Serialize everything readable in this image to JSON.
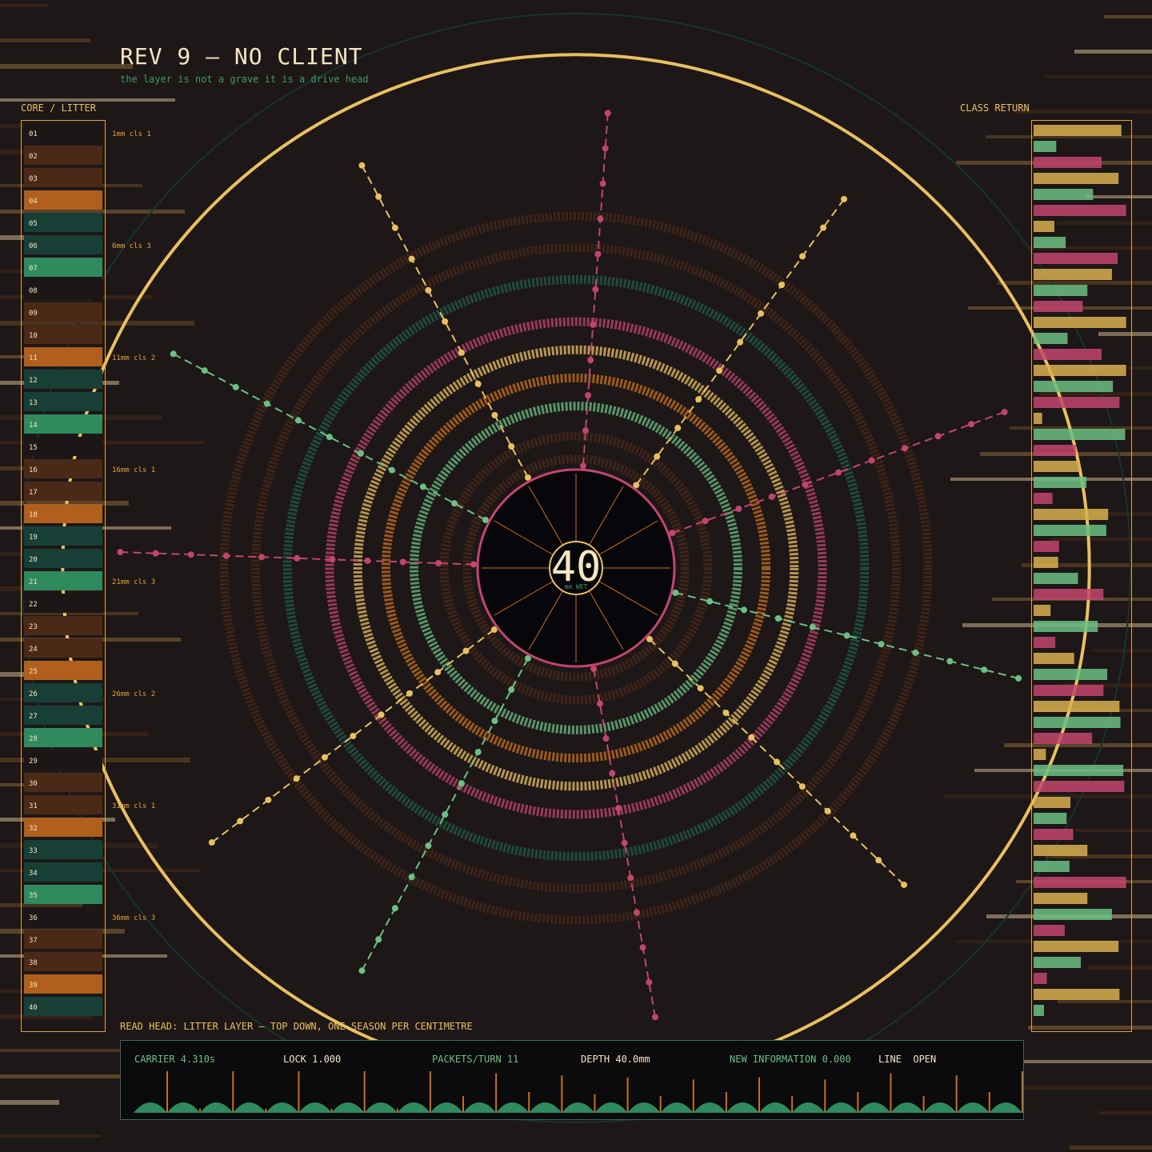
{
  "header": {
    "title": "REV 9 — NO CLIENT",
    "subtitle": "the layer is not a grave it is a drive head"
  },
  "panels": {
    "left_label": "CORE / LITTER",
    "right_label": "CLASS RETURN"
  },
  "readhead": "READ HEAD: LITTER LAYER — TOP DOWN, ONE SEASON PER CENTIMETRE",
  "center": {
    "value": "40",
    "unit": "mm WET"
  },
  "status": {
    "carrier": "CARRIER 4.310s",
    "lock": "LOCK 1.000",
    "packets": "PACKETS/TURN 11",
    "depth": "DEPTH 40.0mm",
    "new_info": "NEW INFORMATION 0.000",
    "line": "LINE  OPEN"
  },
  "colors": {
    "background": "#1d1718",
    "gold": "#e9c060",
    "amber": "#e9a23a",
    "orange": "#c8701e",
    "magenta": "#c2456e",
    "green": "#6cc083",
    "teal": "#1f5e4a",
    "deep_teal": "#16352d",
    "brown": "#4a2a17",
    "cream": "#f3e6c2"
  },
  "core": {
    "layers": [
      {
        "num": "01",
        "kind": "dark"
      },
      {
        "num": "02",
        "kind": "brown"
      },
      {
        "num": "03",
        "kind": "brown"
      },
      {
        "num": "04",
        "kind": "orange"
      },
      {
        "num": "05",
        "kind": "teal"
      },
      {
        "num": "06",
        "kind": "teal"
      },
      {
        "num": "07",
        "kind": "green"
      },
      {
        "num": "08",
        "kind": "dark"
      },
      {
        "num": "09",
        "kind": "brown"
      },
      {
        "num": "10",
        "kind": "brown"
      },
      {
        "num": "11",
        "kind": "orange"
      },
      {
        "num": "12",
        "kind": "teal"
      },
      {
        "num": "13",
        "kind": "teal"
      },
      {
        "num": "14",
        "kind": "green"
      },
      {
        "num": "15",
        "kind": "dark"
      },
      {
        "num": "16",
        "kind": "brown"
      },
      {
        "num": "17",
        "kind": "brown"
      },
      {
        "num": "18",
        "kind": "orange"
      },
      {
        "num": "19",
        "kind": "teal"
      },
      {
        "num": "20",
        "kind": "teal"
      },
      {
        "num": "21",
        "kind": "green"
      },
      {
        "num": "22",
        "kind": "dark"
      },
      {
        "num": "23",
        "kind": "brown"
      },
      {
        "num": "24",
        "kind": "brown"
      },
      {
        "num": "25",
        "kind": "orange"
      },
      {
        "num": "26",
        "kind": "teal"
      },
      {
        "num": "27",
        "kind": "teal"
      },
      {
        "num": "28",
        "kind": "green"
      },
      {
        "num": "29",
        "kind": "dark"
      },
      {
        "num": "30",
        "kind": "brown"
      },
      {
        "num": "31",
        "kind": "brown"
      },
      {
        "num": "32",
        "kind": "orange"
      },
      {
        "num": "33",
        "kind": "teal"
      },
      {
        "num": "34",
        "kind": "teal"
      },
      {
        "num": "35",
        "kind": "green"
      },
      {
        "num": "36",
        "kind": "dark"
      },
      {
        "num": "37",
        "kind": "brown"
      },
      {
        "num": "38",
        "kind": "brown"
      },
      {
        "num": "39",
        "kind": "orange"
      },
      {
        "num": "40",
        "kind": "teal"
      }
    ],
    "depth_marks": [
      {
        "layer": 1,
        "text": "1mm  cls 1"
      },
      {
        "layer": 6,
        "text": "6mm  cls 3"
      },
      {
        "layer": 11,
        "text": "11mm  cls 2"
      },
      {
        "layer": 16,
        "text": "16mm  cls 1"
      },
      {
        "layer": 21,
        "text": "21mm  cls 3"
      },
      {
        "layer": 26,
        "text": "26mm  cls 2"
      },
      {
        "layer": 31,
        "text": "31mm  cls 1"
      },
      {
        "layer": 36,
        "text": "36mm  cls 3"
      }
    ]
  },
  "class_return": [
    {
      "cls": 3,
      "level": 0.93
    },
    {
      "cls": 2,
      "level": 0.24
    },
    {
      "cls": 1,
      "level": 0.72
    },
    {
      "cls": 3,
      "level": 0.9
    },
    {
      "cls": 2,
      "level": 0.63
    },
    {
      "cls": 1,
      "level": 0.98
    },
    {
      "cls": 3,
      "level": 0.22
    },
    {
      "cls": 2,
      "level": 0.34
    },
    {
      "cls": 1,
      "level": 0.89
    },
    {
      "cls": 3,
      "level": 0.83
    },
    {
      "cls": 2,
      "level": 0.57
    },
    {
      "cls": 1,
      "level": 0.52
    },
    {
      "cls": 3,
      "level": 0.98
    },
    {
      "cls": 2,
      "level": 0.36
    },
    {
      "cls": 1,
      "level": 0.72
    },
    {
      "cls": 3,
      "level": 0.98
    },
    {
      "cls": 2,
      "level": 0.84
    },
    {
      "cls": 1,
      "level": 0.91
    },
    {
      "cls": 3,
      "level": 0.09
    },
    {
      "cls": 2,
      "level": 0.97
    },
    {
      "cls": 1,
      "level": 0.45
    },
    {
      "cls": 3,
      "level": 0.49
    },
    {
      "cls": 2,
      "level": 0.56
    },
    {
      "cls": 1,
      "level": 0.2
    },
    {
      "cls": 3,
      "level": 0.79
    },
    {
      "cls": 2,
      "level": 0.77
    },
    {
      "cls": 1,
      "level": 0.27
    },
    {
      "cls": 3,
      "level": 0.26
    },
    {
      "cls": 2,
      "level": 0.47
    },
    {
      "cls": 1,
      "level": 0.74
    },
    {
      "cls": 3,
      "level": 0.18
    },
    {
      "cls": 2,
      "level": 0.68
    },
    {
      "cls": 1,
      "level": 0.23
    },
    {
      "cls": 3,
      "level": 0.43
    },
    {
      "cls": 2,
      "level": 0.78
    },
    {
      "cls": 1,
      "level": 0.74
    },
    {
      "cls": 3,
      "level": 0.91
    },
    {
      "cls": 2,
      "level": 0.92
    },
    {
      "cls": 1,
      "level": 0.62
    },
    {
      "cls": 3,
      "level": 0.13
    },
    {
      "cls": 2,
      "level": 0.95
    },
    {
      "cls": 1,
      "level": 0.96
    },
    {
      "cls": 3,
      "level": 0.39
    },
    {
      "cls": 2,
      "level": 0.35
    },
    {
      "cls": 1,
      "level": 0.42
    },
    {
      "cls": 3,
      "level": 0.57
    },
    {
      "cls": 2,
      "level": 0.38
    },
    {
      "cls": 1,
      "level": 0.98
    },
    {
      "cls": 3,
      "level": 0.57
    },
    {
      "cls": 2,
      "level": 0.83
    },
    {
      "cls": 1,
      "level": 0.33
    },
    {
      "cls": 3,
      "level": 0.9
    },
    {
      "cls": 2,
      "level": 0.5
    },
    {
      "cls": 1,
      "level": 0.14
    },
    {
      "cls": 3,
      "level": 0.91
    },
    {
      "cls": 2,
      "level": 0.11
    }
  ],
  "rings": [
    {
      "radius": 0.27,
      "tone": "teal"
    },
    {
      "radius": 0.31,
      "tone": "brown"
    },
    {
      "radius": 0.375,
      "tone": "brown"
    },
    {
      "radius": 0.46,
      "tone": "green"
    },
    {
      "radius": 0.54,
      "tone": "orange"
    },
    {
      "radius": 0.62,
      "tone": "gold"
    },
    {
      "radius": 0.7,
      "tone": "magenta"
    },
    {
      "radius": 0.82,
      "tone": "teal"
    },
    {
      "radius": 0.91,
      "tone": "brown"
    },
    {
      "radius": 1.0,
      "tone": "brown"
    }
  ],
  "spokes": [
    {
      "angle": 274,
      "tone": "magenta"
    },
    {
      "angle": 306,
      "tone": "gold"
    },
    {
      "angle": 340,
      "tone": "magenta"
    },
    {
      "angle": 14,
      "tone": "green"
    },
    {
      "angle": 44,
      "tone": "gold"
    },
    {
      "angle": 80,
      "tone": "magenta"
    },
    {
      "angle": 118,
      "tone": "green"
    },
    {
      "angle": 143,
      "tone": "gold"
    },
    {
      "angle": 182,
      "tone": "magenta"
    },
    {
      "angle": 208,
      "tone": "green"
    },
    {
      "angle": 242,
      "tone": "gold"
    }
  ],
  "signal": {
    "humps": 27,
    "spikes": [
      1.0,
      0.1,
      1.0,
      0.1,
      1.0,
      0.1,
      1.0,
      0.1,
      1.0,
      0.4,
      0.95,
      0.5,
      0.9,
      0.45,
      0.85,
      0.4,
      0.8,
      0.5,
      0.85,
      0.4,
      0.8,
      0.5,
      0.95,
      0.4,
      0.9,
      0.5,
      1.0
    ]
  }
}
